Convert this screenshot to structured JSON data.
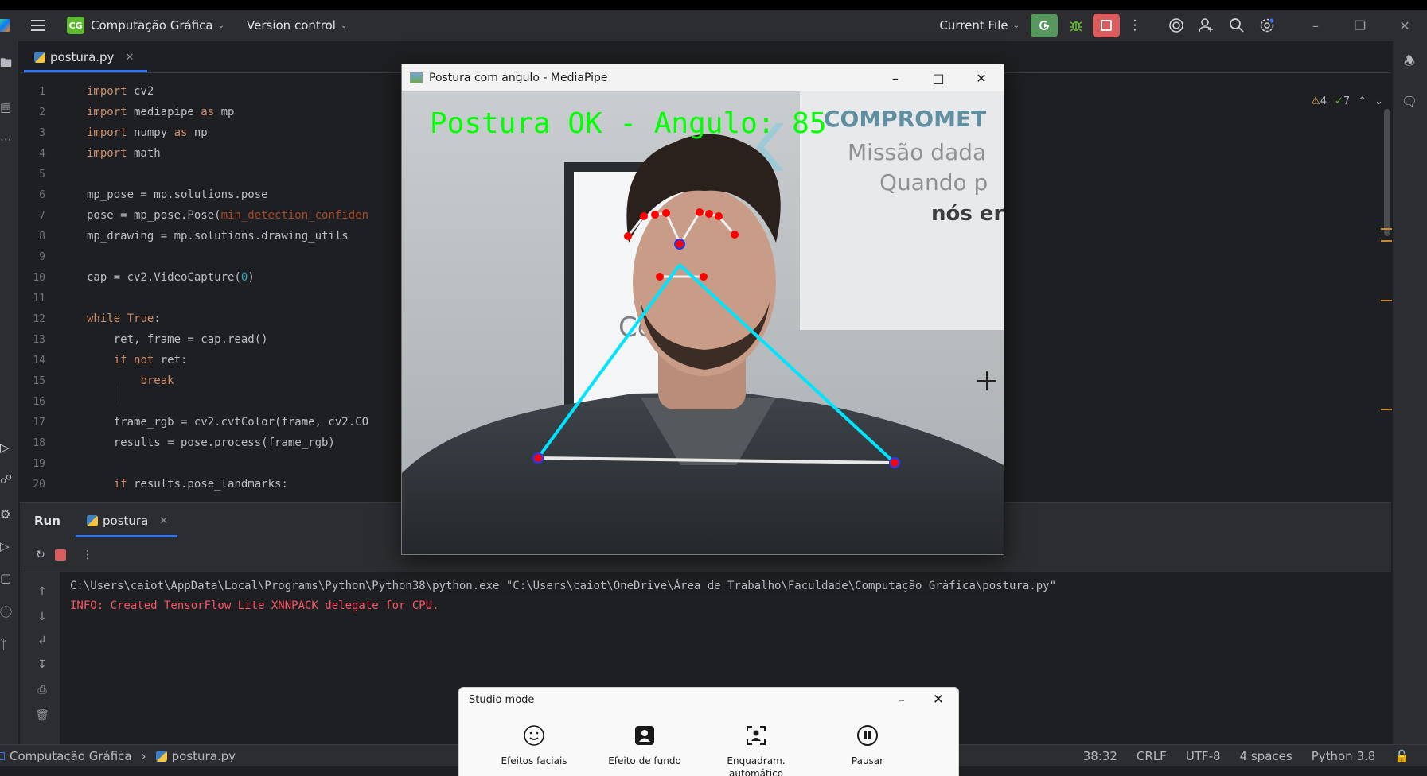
{
  "titlebar": {
    "project_badge": "CG",
    "project_name": "Computação Gráfica",
    "vcs_label": "Version control",
    "run_config": "Current File"
  },
  "editor": {
    "tab_name": "postura.py",
    "inspections": {
      "warnings": "4",
      "ok": "7"
    },
    "line_numbers": [
      "1",
      "2",
      "3",
      "4",
      "5",
      "6",
      "7",
      "8",
      "9",
      "10",
      "11",
      "12",
      "13",
      "14",
      "15",
      "16",
      "17",
      "18",
      "19",
      "20"
    ],
    "code_lines": [
      "import cv2",
      "import mediapipe as mp",
      "import numpy as np",
      "import math",
      "",
      "mp_pose = mp.solutions.pose",
      "pose = mp_pose.Pose(min_detection_confiden",
      "mp_drawing = mp.solutions.drawing_utils",
      "",
      "cap = cv2.VideoCapture(0)",
      "",
      "while True:",
      "    ret, frame = cap.read()",
      "    if not ret:",
      "        break",
      "",
      "    frame_rgb = cv2.cvtColor(frame, cv2.CO",
      "    results = pose.process(frame_rgb)",
      "",
      "    if results.pose_landmarks:"
    ]
  },
  "run_panel": {
    "label": "Run",
    "tab_name": "postura",
    "console": [
      "C:\\Users\\caiot\\AppData\\Local\\Programs\\Python\\Python38\\python.exe \"C:\\Users\\caiot\\OneDrive\\Área de Trabalho\\Faculdade\\Computação Gráfica\\postura.py\"",
      "INFO: Created TensorFlow Lite XNNPACK delegate for CPU."
    ]
  },
  "statusbar": {
    "project": "Computação Gráfica",
    "file": "postura.py",
    "position": "38:32",
    "line_sep": "CRLF",
    "encoding": "UTF-8",
    "indent": "4 spaces",
    "interpreter": "Python 3.8"
  },
  "mediapipe_window": {
    "title": "Postura com angulo - MediaPipe",
    "overlay_text": "Postura OK - Angulo: 85",
    "background_sign": [
      "COMPROMET",
      "Missão dada",
      "Quando p",
      "nós er"
    ],
    "background_text": "Ce"
  },
  "studio_mode": {
    "title": "Studio mode",
    "items": [
      {
        "label": "Efeitos faciais",
        "icon": "smile-icon"
      },
      {
        "label": "Efeito de fundo",
        "icon": "person-background-icon"
      },
      {
        "label": "Enquadram. automático",
        "icon": "auto-frame-icon"
      },
      {
        "label": "Pausar",
        "icon": "pause-icon"
      }
    ]
  },
  "colors": {
    "ide_bg": "#1e1f22",
    "ide_panel": "#2b2d30",
    "accent": "#3574f0",
    "run_green": "#57965c",
    "stop_red": "#db5c5c",
    "overlay_green": "#00ff00",
    "skeleton_cyan": "#00e5ff",
    "landmark_red": "#ff0000"
  }
}
